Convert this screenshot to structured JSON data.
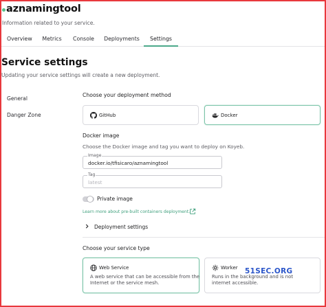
{
  "header": {
    "app_name": "aznamingtool",
    "subtitle": "Information related to your service."
  },
  "tabs": [
    {
      "label": "Overview",
      "active": false
    },
    {
      "label": "Metrics",
      "active": false
    },
    {
      "label": "Console",
      "active": false
    },
    {
      "label": "Deployments",
      "active": false
    },
    {
      "label": "Settings",
      "active": true
    }
  ],
  "page": {
    "title": "Service settings",
    "description": "Updating your service settings will create a new deployment."
  },
  "sidebar": {
    "items": [
      {
        "label": "General"
      },
      {
        "label": "Danger Zone"
      }
    ]
  },
  "deployment": {
    "heading": "Choose your deployment method",
    "methods": [
      {
        "label": "GitHub",
        "icon": "github-icon",
        "selected": false
      },
      {
        "label": "Docker",
        "icon": "docker-icon",
        "selected": true
      }
    ]
  },
  "docker_image": {
    "heading": "Docker image",
    "description": "Choose the Docker image and tag you want to deploy on Koyeb.",
    "image_label": "Image",
    "image_value": "docker.io/tfisicaro/aznamingtool",
    "tag_label": "Tag",
    "tag_placeholder": "latest",
    "private_image_label": "Private image",
    "private_image_enabled": false,
    "learn_more": "Learn more about pre-built containers deployment.",
    "deployment_settings_label": "Deployment settings"
  },
  "service_type": {
    "heading": "Choose your service type",
    "types": [
      {
        "label": "Web Service",
        "icon": "globe-icon",
        "selected": true,
        "description": "A web service that can be accessible from the Internet or the service mesh."
      },
      {
        "label": "Worker",
        "icon": "gear-icon",
        "selected": false,
        "description": "Runs in the background and is not internet accessible."
      }
    ]
  },
  "watermark": "51SEC.ORG",
  "colors": {
    "accent": "#4aa889",
    "selected_border": "#7cc4a9",
    "frame": "#e8383d",
    "link": "#3e9f7c",
    "watermark": "#2a55c9"
  }
}
